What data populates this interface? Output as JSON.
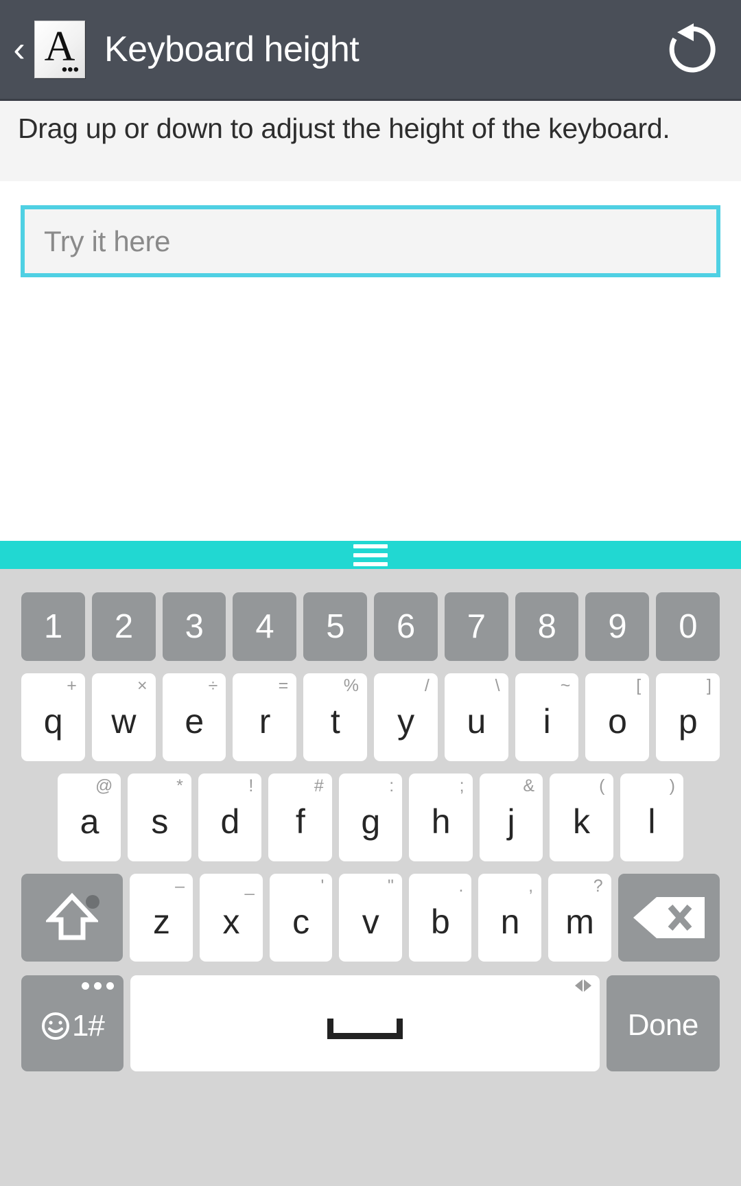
{
  "titlebar": {
    "back_icon": "chevron-left-icon",
    "app_icon_letter": "A",
    "app_icon_dots": "•••",
    "title": "Keyboard height",
    "reset_icon": "reset-rotate-left-icon"
  },
  "instruction": {
    "text": "Drag up or down to adjust the height of the keyboard."
  },
  "test_field": {
    "value": "",
    "placeholder": "Try it here",
    "border_color": "#4fd0e3"
  },
  "drag_handle": {
    "icon": "drag-handle-icon",
    "color": "#21d8d2"
  },
  "keyboard": {
    "background": "#d5d5d5",
    "key_white": "#ffffff",
    "key_gray": "#949799",
    "rows": {
      "numbers": [
        {
          "main": "1"
        },
        {
          "main": "2"
        },
        {
          "main": "3"
        },
        {
          "main": "4"
        },
        {
          "main": "5"
        },
        {
          "main": "6"
        },
        {
          "main": "7"
        },
        {
          "main": "8"
        },
        {
          "main": "9"
        },
        {
          "main": "0"
        }
      ],
      "top": [
        {
          "main": "q",
          "alt": "+"
        },
        {
          "main": "w",
          "alt": "×"
        },
        {
          "main": "e",
          "alt": "÷"
        },
        {
          "main": "r",
          "alt": "="
        },
        {
          "main": "t",
          "alt": "%"
        },
        {
          "main": "y",
          "alt": "/"
        },
        {
          "main": "u",
          "alt": "\\"
        },
        {
          "main": "i",
          "alt": "~"
        },
        {
          "main": "o",
          "alt": "["
        },
        {
          "main": "p",
          "alt": "]"
        }
      ],
      "home": [
        {
          "main": "a",
          "alt": "@"
        },
        {
          "main": "s",
          "alt": "*"
        },
        {
          "main": "d",
          "alt": "!"
        },
        {
          "main": "f",
          "alt": "#"
        },
        {
          "main": "g",
          "alt": ":"
        },
        {
          "main": "h",
          "alt": ";"
        },
        {
          "main": "j",
          "alt": "&"
        },
        {
          "main": "k",
          "alt": "("
        },
        {
          "main": "l",
          "alt": ")"
        }
      ],
      "bottom": [
        {
          "main": "z",
          "alt": "–"
        },
        {
          "main": "x",
          "alt": "_"
        },
        {
          "main": "c",
          "alt": "'"
        },
        {
          "main": "v",
          "alt": "\""
        },
        {
          "main": "b",
          "alt": "."
        },
        {
          "main": "n",
          "alt": ","
        },
        {
          "main": "m",
          "alt": "?"
        }
      ]
    },
    "shift": {
      "icon": "shift-up-arrow-icon"
    },
    "backspace": {
      "icon": "backspace-delete-icon"
    },
    "symbols_key": {
      "label": "1#",
      "icon": "smiley-face-icon",
      "more_dots": "•••"
    },
    "spacebar": {
      "icon": "space-bar-icon",
      "cursor_arrows_icon": "left-right-arrows-icon"
    },
    "done_key": {
      "label": "Done"
    }
  }
}
